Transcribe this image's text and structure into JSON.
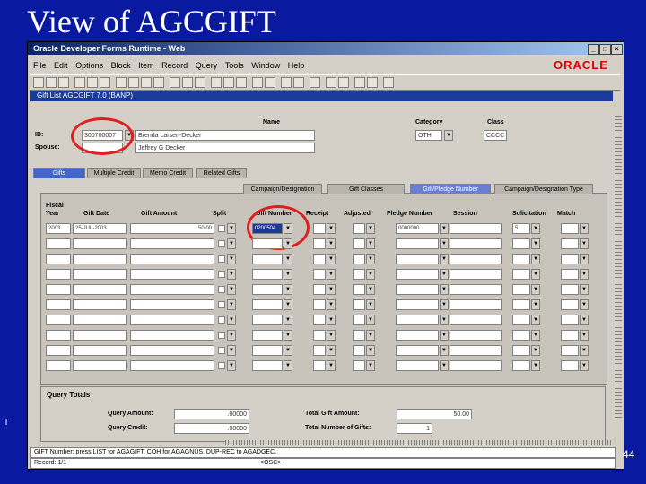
{
  "slide": {
    "title": "View of AGCGIFT",
    "page_number": "44",
    "side_mark": "T"
  },
  "window": {
    "title": "Oracle Developer Forms Runtime - Web",
    "menu": [
      "File",
      "Edit",
      "Options",
      "Block",
      "Item",
      "Record",
      "Query",
      "Tools",
      "Window",
      "Help"
    ],
    "brand": "ORACLE",
    "form_title": "Gift List AGCGIFT 7.0 (BANP)"
  },
  "header": {
    "id_label": "ID:",
    "id_value": "300700007",
    "name_label": "Name",
    "name_value": "Brenda Larsen-Decker",
    "spouse_label": "Spouse:",
    "spouse_value": "Jeffrey G Decker",
    "category_label": "Category",
    "category_value": "OTH",
    "class_label": "Class",
    "class_value": "CCCC"
  },
  "tabs": [
    "Gifts",
    "Multiple Credit",
    "Memo Credit",
    "Related Gifts"
  ],
  "subtabs": [
    "Campaign/Designation",
    "Gift Classes",
    "Gift/Pledge Number",
    "Campaign/Designation Type"
  ],
  "columns": {
    "fiscal_year": "Fiscal\nYear",
    "gift_date": "Gift Date",
    "gift_amount": "Gift Amount",
    "split": "Split",
    "gift_number": "Gift Number",
    "receipt": "Receipt",
    "adjusted": "Adjusted",
    "pledge_number": "Pledge Number",
    "session": "Session",
    "solicitation": "Solicitation",
    "match": "Match"
  },
  "first_row": {
    "fiscal_year": "2003",
    "gift_date": "25-JUL-2003",
    "gift_amount": "50.00",
    "gift_number": "0200504",
    "pledge_number": "0000000",
    "solicitation": "5"
  },
  "totals": {
    "heading": "Query Totals",
    "query_amount_label": "Query Amount:",
    "query_amount": ".00000",
    "query_credit_label": "Query Credit:",
    "query_credit": ".00000",
    "total_gift_amount_label": "Total Gift Amount:",
    "total_gift_amount": "50.00",
    "total_number_label": "Total Number of Gifts:",
    "total_number": "1"
  },
  "status": {
    "line1": "GIFT Number: press LIST for AGAGIFT, COH for AGAGNUS, DUP-REC to AGADGEC.",
    "line2_left": "Record: 1/1",
    "line2_right": "<OSC>"
  },
  "colors": {
    "background": "#0a1aa0",
    "highlight_circle": "#e02020",
    "oracle_red": "#e00000"
  }
}
